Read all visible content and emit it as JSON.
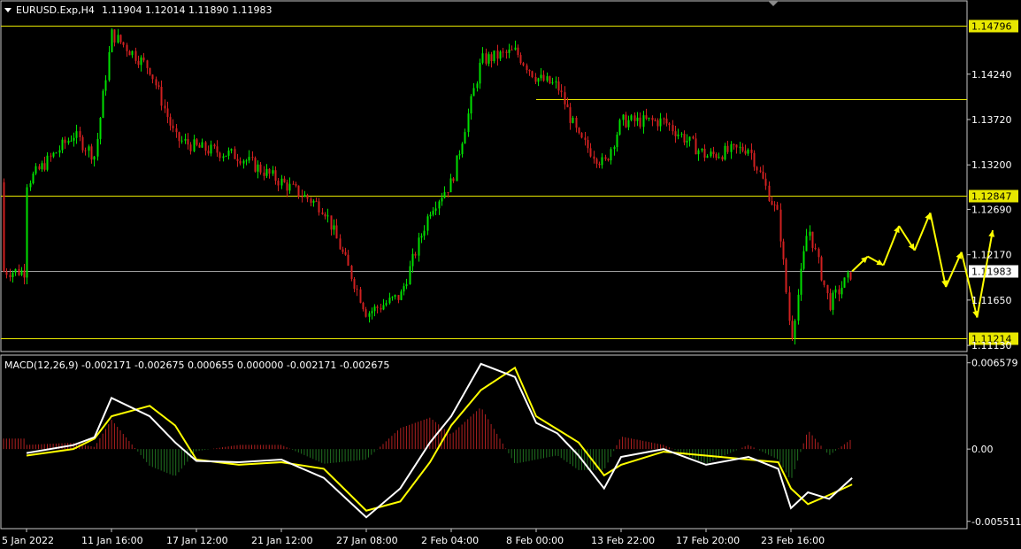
{
  "header": {
    "symbol": "EURUSD.Exp,H4",
    "ohlc": "1.11904 1.12014 1.11890 1.11983"
  },
  "macd": {
    "label": "MACD(12,26,9) -0.002171 -0.002675 0.000655 0.000000 -0.002171 -0.002675"
  },
  "colors": {
    "background": "#000000",
    "bull": "#00e000",
    "bear": "#d02020",
    "level_line": "#e8e800",
    "macd_main": "#ffffff",
    "macd_signal": "#ffff00",
    "forecast": "#ffff00"
  },
  "chart_data": {
    "type": "candlestick",
    "symbol": "EURUSD.Exp",
    "timeframe": "H4",
    "price_axis": {
      "ticks": [
        "1.14240",
        "1.13720",
        "1.13200",
        "1.12690",
        "1.12170",
        "1.11650",
        "1.11130"
      ],
      "ylim": [
        1.1107,
        1.1507
      ]
    },
    "levels": [
      {
        "label": "1.14796",
        "value": 1.14796
      },
      {
        "label": "1.12847",
        "value": 1.12847
      },
      {
        "label": "1.11214",
        "value": 1.11214
      }
    ],
    "partial_level": {
      "value": 1.1395,
      "from": "8 Feb 00:00"
    },
    "current_price": {
      "label": "1.11983",
      "value": 1.11983
    },
    "x_ticks": [
      "5 Jan 2022",
      "11 Jan 16:00",
      "17 Jan 12:00",
      "21 Jan 12:00",
      "27 Jan 08:00",
      "2 Feb 04:00",
      "8 Feb 00:00",
      "13 Feb 22:00",
      "17 Feb 20:00",
      "23 Feb 16:00"
    ],
    "close_path": [
      {
        "x": "5 Jan 2022",
        "y": 1.13
      },
      {
        "x": "8 Jan",
        "y": 1.1355
      },
      {
        "x": "10 Jan",
        "y": 1.133
      },
      {
        "x": "11 Jan 16:00",
        "y": 1.147
      },
      {
        "x": "13 Jan",
        "y": 1.143
      },
      {
        "x": "15 Jan",
        "y": 1.135
      },
      {
        "x": "17 Jan 12:00",
        "y": 1.134
      },
      {
        "x": "19 Jan",
        "y": 1.133
      },
      {
        "x": "21 Jan 12:00",
        "y": 1.13
      },
      {
        "x": "24 Jan",
        "y": 1.127
      },
      {
        "x": "27 Jan 08:00",
        "y": 1.115
      },
      {
        "x": "29 Jan",
        "y": 1.117
      },
      {
        "x": "31 Jan",
        "y": 1.127
      },
      {
        "x": "2 Feb 04:00",
        "y": 1.13
      },
      {
        "x": "3 Feb",
        "y": 1.144
      },
      {
        "x": "5 Feb",
        "y": 1.145
      },
      {
        "x": "8 Feb 00:00",
        "y": 1.142
      },
      {
        "x": "9 Feb",
        "y": 1.141
      },
      {
        "x": "10 Feb",
        "y": 1.135
      },
      {
        "x": "12 Feb",
        "y": 1.132
      },
      {
        "x": "13 Feb 22:00",
        "y": 1.137
      },
      {
        "x": "15 Feb",
        "y": 1.137
      },
      {
        "x": "17 Feb 20:00",
        "y": 1.133
      },
      {
        "x": "20 Feb",
        "y": 1.134
      },
      {
        "x": "22 Feb",
        "y": 1.126
      },
      {
        "x": "23 Feb 16:00",
        "y": 1.112
      },
      {
        "x": "24 Feb",
        "y": 1.125
      },
      {
        "x": "25 Feb",
        "y": 1.116
      },
      {
        "x": "26 Feb",
        "y": 1.1198
      }
    ],
    "forecast_path": [
      1.1198,
      1.1215,
      1.1205,
      1.125,
      1.1222,
      1.1265,
      1.118,
      1.122,
      1.1145,
      1.1245
    ],
    "macd_axis": {
      "ticks": [
        "0.006579",
        "0.00",
        "-0.005511"
      ],
      "ylim": [
        -0.006,
        0.0071
      ]
    },
    "macd_main": [
      {
        "x": "5 Jan 2022",
        "y": -0.0003
      },
      {
        "x": "8 Jan",
        "y": 0.0003
      },
      {
        "x": "10 Jan",
        "y": 0.0009
      },
      {
        "x": "11 Jan 16:00",
        "y": 0.0039
      },
      {
        "x": "13 Jan",
        "y": 0.0025
      },
      {
        "x": "15 Jan",
        "y": 0.0005
      },
      {
        "x": "17 Jan 12:00",
        "y": -0.0009
      },
      {
        "x": "19 Jan",
        "y": -0.001
      },
      {
        "x": "21 Jan 12:00",
        "y": -0.0008
      },
      {
        "x": "24 Jan",
        "y": -0.0022
      },
      {
        "x": "27 Jan 08:00",
        "y": -0.0052
      },
      {
        "x": "29 Jan",
        "y": -0.003
      },
      {
        "x": "31 Jan",
        "y": 0.0005
      },
      {
        "x": "2 Feb 04:00",
        "y": 0.0025
      },
      {
        "x": "3 Feb",
        "y": 0.0065
      },
      {
        "x": "5 Feb",
        "y": 0.0055
      },
      {
        "x": "8 Feb 00:00",
        "y": 0.002
      },
      {
        "x": "9 Feb",
        "y": 0.0012
      },
      {
        "x": "10 Feb",
        "y": -0.0005
      },
      {
        "x": "12 Feb",
        "y": -0.003
      },
      {
        "x": "13 Feb 22:00",
        "y": -0.0006
      },
      {
        "x": "15 Feb",
        "y": 0.0
      },
      {
        "x": "17 Feb 20:00",
        "y": -0.0012
      },
      {
        "x": "20 Feb",
        "y": -0.0006
      },
      {
        "x": "22 Feb",
        "y": -0.0015
      },
      {
        "x": "23 Feb 16:00",
        "y": -0.0045
      },
      {
        "x": "24 Feb",
        "y": -0.0033
      },
      {
        "x": "25 Feb",
        "y": -0.0038
      },
      {
        "x": "26 Feb",
        "y": -0.0022
      }
    ],
    "macd_signal": [
      {
        "x": "5 Jan 2022",
        "y": -0.0005
      },
      {
        "x": "8 Jan",
        "y": 0.0
      },
      {
        "x": "10 Jan",
        "y": 0.0008
      },
      {
        "x": "11 Jan 16:00",
        "y": 0.0025
      },
      {
        "x": "13 Jan",
        "y": 0.0033
      },
      {
        "x": "15 Jan",
        "y": 0.0018
      },
      {
        "x": "17 Jan 12:00",
        "y": -0.0008
      },
      {
        "x": "19 Jan",
        "y": -0.0012
      },
      {
        "x": "21 Jan 12:00",
        "y": -0.001
      },
      {
        "x": "24 Jan",
        "y": -0.0015
      },
      {
        "x": "27 Jan 08:00",
        "y": -0.0047
      },
      {
        "x": "29 Jan",
        "y": -0.004
      },
      {
        "x": "31 Jan",
        "y": -0.001
      },
      {
        "x": "2 Feb 04:00",
        "y": 0.0018
      },
      {
        "x": "3 Feb",
        "y": 0.0045
      },
      {
        "x": "5 Feb",
        "y": 0.0062
      },
      {
        "x": "8 Feb 00:00",
        "y": 0.0025
      },
      {
        "x": "9 Feb",
        "y": 0.0015
      },
      {
        "x": "10 Feb",
        "y": 0.0005
      },
      {
        "x": "12 Feb",
        "y": -0.002
      },
      {
        "x": "13 Feb 22:00",
        "y": -0.0012
      },
      {
        "x": "15 Feb",
        "y": -0.0002
      },
      {
        "x": "17 Feb 20:00",
        "y": -0.0005
      },
      {
        "x": "20 Feb",
        "y": -0.0008
      },
      {
        "x": "22 Feb",
        "y": -0.001
      },
      {
        "x": "23 Feb 16:00",
        "y": -0.003
      },
      {
        "x": "24 Feb",
        "y": -0.0042
      },
      {
        "x": "25 Feb",
        "y": -0.0035
      },
      {
        "x": "26 Feb",
        "y": -0.0027
      }
    ]
  }
}
